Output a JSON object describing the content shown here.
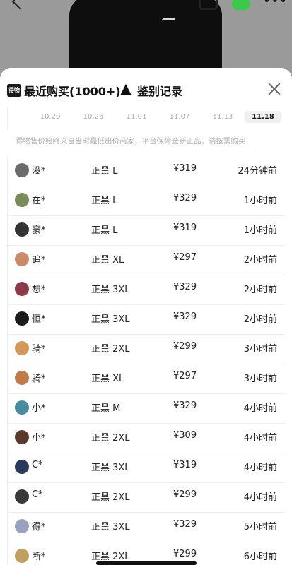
{
  "tabs": {
    "recent_label": "最近购买(1000+)",
    "auth_label": "鉴别记录",
    "dw_logo_text": "得物"
  },
  "chart": {
    "dates": [
      "10.20",
      "10.26",
      "11.01",
      "11.07",
      "11.13",
      "11.18"
    ],
    "active_index": 5
  },
  "notice": "得物售价始终来自当时最低出价商家，平台保障全新正品，请按需购买",
  "purchases": [
    {
      "user": "没*",
      "spec": "正黑 L",
      "price": "¥319",
      "time": "24分钟前",
      "avatar_color": "#6b6b6b"
    },
    {
      "user": "在*",
      "spec": "正黑 L",
      "price": "¥329",
      "time": "1小时前",
      "avatar_color": "#7a8a5a"
    },
    {
      "user": "豪*",
      "spec": "正黑 L",
      "price": "¥319",
      "time": "1小时前",
      "avatar_color": "#333333"
    },
    {
      "user": "追*",
      "spec": "正黑 XL",
      "price": "¥297",
      "time": "2小时前",
      "avatar_color": "#c98a6a"
    },
    {
      "user": "想*",
      "spec": "正黑 3XL",
      "price": "¥329",
      "time": "2小时前",
      "avatar_color": "#8a3a4a"
    },
    {
      "user": "恒*",
      "spec": "正黑 3XL",
      "price": "¥329",
      "time": "2小时前",
      "avatar_color": "#1a1a1a"
    },
    {
      "user": "骑*",
      "spec": "正黑 2XL",
      "price": "¥299",
      "time": "3小时前",
      "avatar_color": "#d29a5a"
    },
    {
      "user": "骑*",
      "spec": "正黑 XL",
      "price": "¥297",
      "time": "3小时前",
      "avatar_color": "#c07a4a"
    },
    {
      "user": "小*",
      "spec": "正黑 M",
      "price": "¥329",
      "time": "4小时前",
      "avatar_color": "#4a8aa0"
    },
    {
      "user": "小*",
      "spec": "正黑 2XL",
      "price": "¥309",
      "time": "4小时前",
      "avatar_color": "#5a3a2a"
    },
    {
      "user": "C*",
      "spec": "正黑 3XL",
      "price": "¥319",
      "time": "4小时前",
      "avatar_color": "#2a3a5a"
    },
    {
      "user": "C*",
      "spec": "正黑 2XL",
      "price": "¥299",
      "time": "4小时前",
      "avatar_color": "#3a3a3a"
    },
    {
      "user": "得*",
      "spec": "正黑 3XL",
      "price": "¥329",
      "time": "5小时前",
      "avatar_color": "#9aa0c0"
    },
    {
      "user": "断*",
      "spec": "正黑 2XL",
      "price": "¥299",
      "time": "6小时前",
      "avatar_color": "#c0a060"
    }
  ]
}
